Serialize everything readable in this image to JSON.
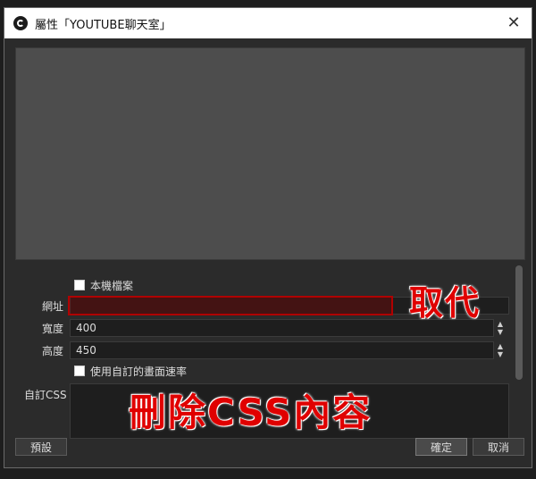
{
  "window": {
    "title": "屬性「YOUTUBE聊天室」"
  },
  "properties": {
    "local_file_label": "本機檔案",
    "url_label": "網址",
    "width_label": "寬度",
    "width_value": "400",
    "height_label": "高度",
    "height_value": "450",
    "custom_fps_label": "使用自訂的畫面速率",
    "custom_css_label": "自訂CSS"
  },
  "buttons": {
    "defaults": "預設",
    "ok": "確定",
    "cancel": "取消"
  },
  "annotations": {
    "replace": "取代",
    "delete_css": "刪除CSS內容"
  }
}
